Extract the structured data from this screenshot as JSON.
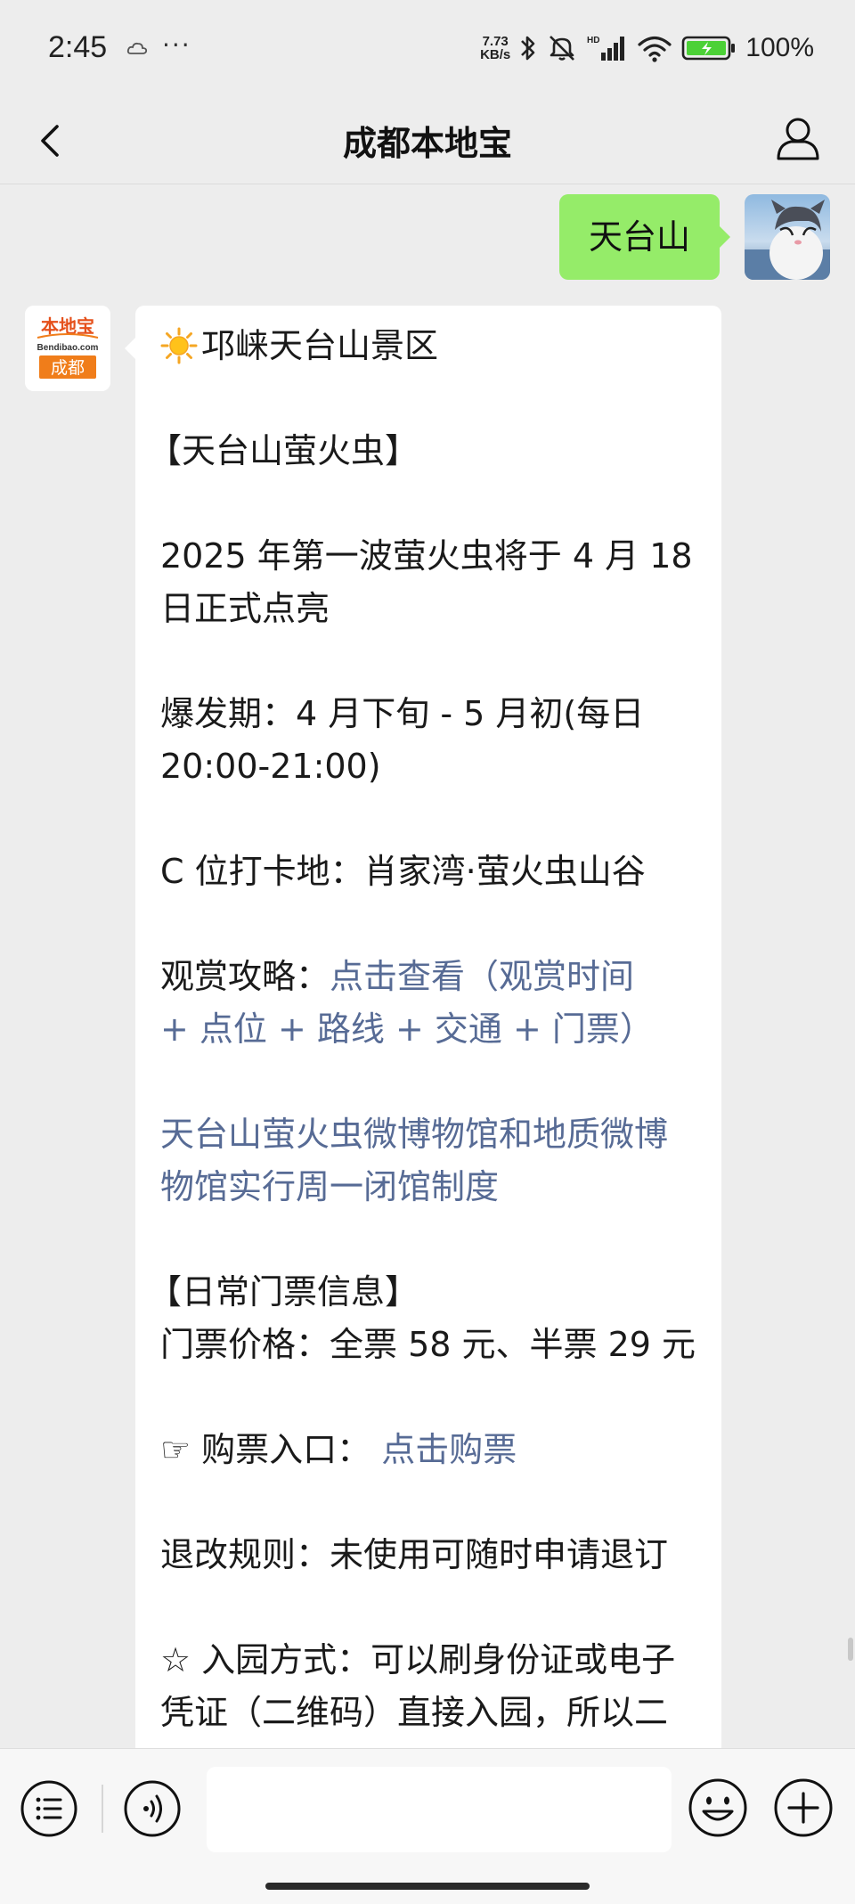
{
  "status_bar": {
    "time": "2:45",
    "more": "···",
    "net_speed_value": "7.73",
    "net_speed_unit": "KB/s",
    "signal_badge": "HD",
    "battery": "100%"
  },
  "header": {
    "title": "成都本地宝"
  },
  "chat": {
    "user_message": "天台山",
    "bot_logo": {
      "top": "本地宝",
      "middle": "Bendibao.com",
      "bottom": "成都"
    },
    "bot_message": {
      "line01": "邛崃天台山景区",
      "line02": "【天台山萤火虫】",
      "line03": "2025 年第一波萤火虫将于 4 月 18",
      "line04": "日正式点亮",
      "line05": "爆发期：4 月下旬 - 5 月初(每日",
      "line06": "20:00-21:00)",
      "line07": "C 位打卡地：肖家湾·萤火虫山谷",
      "line08_label": "观赏攻略：",
      "line08_link": "点击查看（观赏时间",
      "line09_link": "+ 点位 + 路线 + 交通 + 门票）",
      "line10_link": "天台山萤火虫微博物馆和地质微博",
      "line11_link": "物馆实行周一闭馆制度",
      "line12": "【日常门票信息】",
      "line13": "门票价格：全票 58 元、半票 29 元",
      "line14_label": "☞ 购票入口：",
      "line14_link": "点击购票",
      "line15": "退改规则：未使用可随时申请退订",
      "line16": "☆ 入园方式：可以刷身份证或电子",
      "line17": "凭证（二维码）直接入园，所以二"
    }
  },
  "colors": {
    "background": "#ededed",
    "user_bubble": "#95ec69",
    "link": "#576b95",
    "logo_orange": "#f07d1a"
  }
}
